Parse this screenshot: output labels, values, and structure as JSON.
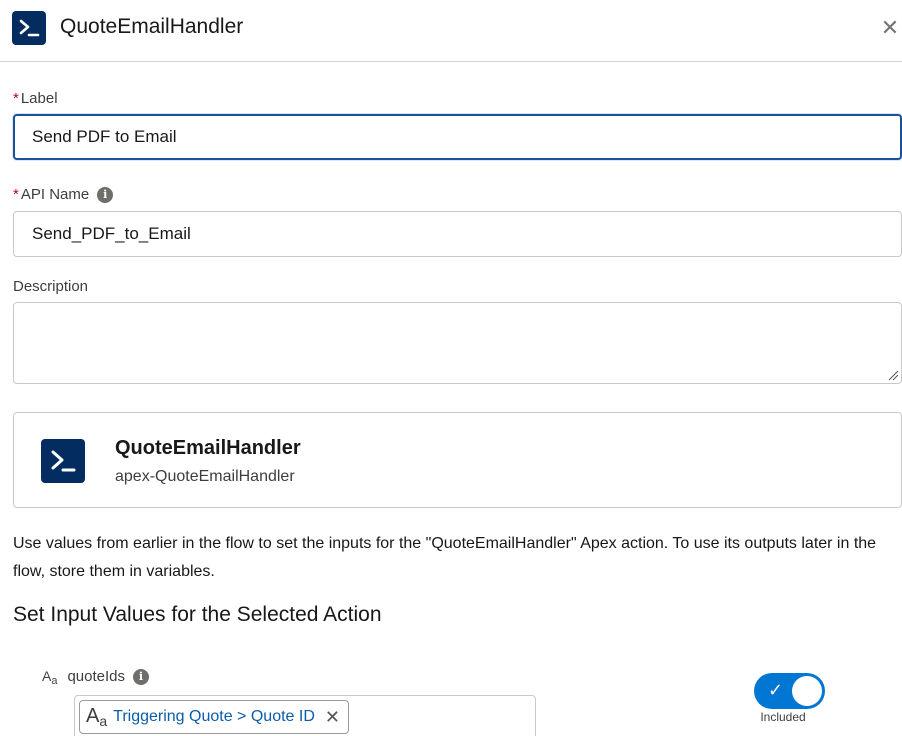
{
  "header": {
    "title": "QuoteEmailHandler",
    "icon": "apex-action-icon",
    "close_glyph": "✕"
  },
  "form": {
    "required_marker": "*",
    "label": {
      "label": "Label",
      "value": "Send PDF to Email"
    },
    "api_name": {
      "label": "API Name",
      "value": "Send_PDF_to_Email"
    },
    "description": {
      "label": "Description",
      "value": ""
    }
  },
  "action_card": {
    "title": "QuoteEmailHandler",
    "subtitle": "apex-QuoteEmailHandler"
  },
  "help_text": "Use values from earlier in the flow to set the inputs for the \"QuoteEmailHandler\" Apex action. To use its outputs later in the flow, store them in variables.",
  "section_title": "Set Input Values for the Selected Action",
  "inputs": [
    {
      "name": "quoteIds",
      "type_icon": "text-type-icon",
      "value_pill": "Triggering Quote > Quote ID",
      "included": true,
      "included_label": "Included"
    }
  ],
  "colors": {
    "brand_navy": "#032d60",
    "toggle_blue": "#0176d3",
    "link_blue": "#0b5cab",
    "required_red": "#ba0517",
    "focus_border": "#1b5297"
  }
}
